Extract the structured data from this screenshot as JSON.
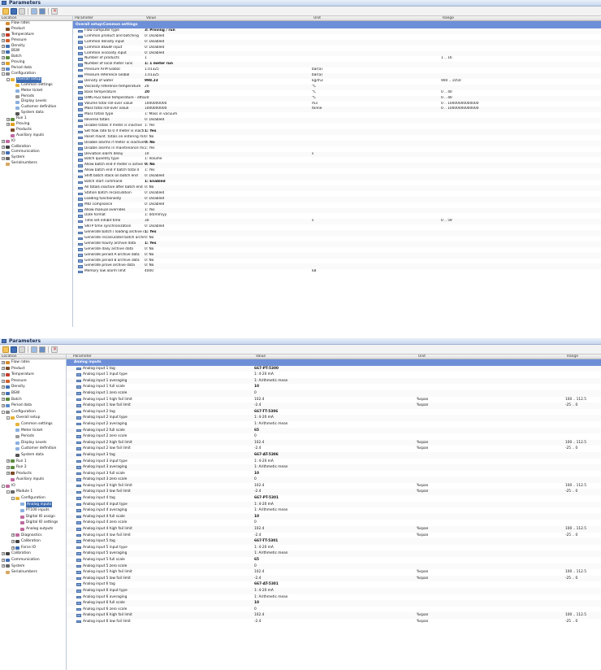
{
  "window1": {
    "title": "Parameters",
    "tree_header": "Location",
    "grid_headers": {
      "parameter": "Parameter",
      "value": "Value",
      "unit": "Unit",
      "range": "Range"
    },
    "section": "Overall setup\\Common settings",
    "tree": [
      {
        "label": "Flow rates",
        "indent": 0,
        "exp": "",
        "icon": "#d48b2e"
      },
      {
        "label": "Product",
        "indent": 0,
        "exp": "",
        "icon": "#7a4b26"
      },
      {
        "label": "Temperature",
        "indent": 0,
        "exp": "+",
        "icon": "#c83c2c"
      },
      {
        "label": "Pressure",
        "indent": 0,
        "exp": "+",
        "icon": "#d0602a"
      },
      {
        "label": "Density",
        "indent": 0,
        "exp": "+",
        "icon": "#3f6fb5"
      },
      {
        "label": "BSW",
        "indent": 0,
        "exp": "+",
        "icon": "#3f6fb5"
      },
      {
        "label": "Batch",
        "indent": 0,
        "exp": "+",
        "icon": "#5c8a3c"
      },
      {
        "label": "Proving",
        "indent": 0,
        "exp": "+",
        "icon": "#e0a020"
      },
      {
        "label": "Period data",
        "indent": 0,
        "exp": "+",
        "icon": "#5a8ad0"
      },
      {
        "label": "Configuration",
        "indent": 0,
        "exp": "-",
        "icon": "#8a8a8a"
      },
      {
        "label": "Overall setup",
        "indent": 1,
        "exp": "-",
        "icon": "#e6b33a",
        "selected": true
      },
      {
        "label": "Common settings",
        "indent": 2,
        "exp": "",
        "icon": "#e6b33a"
      },
      {
        "label": "Meter ticket",
        "indent": 2,
        "exp": "",
        "icon": "#8ab0e0"
      },
      {
        "label": "Periods",
        "indent": 2,
        "exp": "",
        "icon": "#9a9a9a"
      },
      {
        "label": "Display Levels",
        "indent": 2,
        "exp": "",
        "icon": "#8ab0e0"
      },
      {
        "label": "Customer definition",
        "indent": 2,
        "exp": "",
        "icon": "#8ab0e0"
      },
      {
        "label": "System data",
        "indent": 2,
        "exp": "",
        "icon": "#555"
      },
      {
        "label": "Run 1",
        "indent": 1,
        "exp": "+",
        "icon": "#5c8a3c"
      },
      {
        "label": "Proving",
        "indent": 1,
        "exp": "+",
        "icon": "#e0a020"
      },
      {
        "label": "Products",
        "indent": 1,
        "exp": "",
        "icon": "#7a4b26"
      },
      {
        "label": "Auxiliary inputs",
        "indent": 1,
        "exp": "",
        "icon": "#c06aa0"
      },
      {
        "label": "IO",
        "indent": 0,
        "exp": "+",
        "icon": "#c06aa0"
      },
      {
        "label": "Calibration",
        "indent": 0,
        "exp": "+",
        "icon": "#444"
      },
      {
        "label": "Communication",
        "indent": 0,
        "exp": "+",
        "icon": "#3f6fb5"
      },
      {
        "label": "System",
        "indent": 0,
        "exp": "+",
        "icon": "#666"
      },
      {
        "label": "Serialnumbers",
        "indent": 0,
        "exp": "",
        "icon": "#d9a760"
      }
    ],
    "rows": [
      {
        "p": "Flow computer type",
        "v": "3: Proving / run",
        "u": "",
        "r": "",
        "b": true
      },
      {
        "p": "Common product and batching",
        "v": "0: Disabled",
        "u": "",
        "r": ""
      },
      {
        "p": "Common density input",
        "v": "0: Disabled",
        "u": "",
        "r": ""
      },
      {
        "p": "Common BS&W input",
        "v": "0: Disabled",
        "u": "",
        "r": ""
      },
      {
        "p": "Common viscosity input",
        "v": "0: Disabled",
        "u": "",
        "r": ""
      },
      {
        "p": "Number of products",
        "v": "1",
        "u": "",
        "r": "1 .. 16"
      },
      {
        "p": "Number of local meter runs",
        "v": "1: 1 meter run",
        "u": "",
        "r": "",
        "b": true
      },
      {
        "p": "Pressure ATM Global",
        "v": "1.01325",
        "u": "bar(a)",
        "r": ""
      },
      {
        "p": "Pressure reference Global",
        "v": "1.01325",
        "u": "bar(a)",
        "r": ""
      },
      {
        "p": "Density of water",
        "v": "998.23",
        "u": "kg/m3",
        "r": "900 .. 1050",
        "b": true
      },
      {
        "p": "Viscosity reference temperature",
        "v": "20",
        "u": "°C",
        "r": ""
      },
      {
        "p": "Base temperature",
        "v": "20",
        "u": "°C",
        "r": "0 .. 40",
        "b": true
      },
      {
        "p": "OIML-R22 base temperature - ethanol",
        "v": "20",
        "u": "°C",
        "r": "0 .. 40"
      },
      {
        "p": "Volume total roll-over value",
        "v": "1000000000",
        "u": "m3",
        "r": "0 .. 10000000000000"
      },
      {
        "p": "Mass total roll-over value",
        "v": "1000000000",
        "u": "tonne",
        "r": "0 .. 10000000000000"
      },
      {
        "p": "Mass totals type",
        "v": "1: Mass in vacuum",
        "u": "",
        "r": ""
      },
      {
        "p": "Reverse totals",
        "v": "0: Disabled",
        "u": "",
        "r": ""
      },
      {
        "p": "Disable totals if meter is inactive",
        "v": "1: Yes",
        "u": "",
        "r": ""
      },
      {
        "p": "Set flow rate to 0 if meter is inactive",
        "v": "1: Yes",
        "u": "",
        "r": "",
        "b": true
      },
      {
        "p": "Reset maint. totals on entering maint. mode",
        "v": "0: No",
        "u": "",
        "r": ""
      },
      {
        "p": "Disable alarms if meter is inactive",
        "v": "0: No",
        "u": "",
        "r": "",
        "b": true
      },
      {
        "p": "Disable alarms in maintenance mode",
        "v": "1: Yes",
        "u": "",
        "r": ""
      },
      {
        "p": "Deviation alarm delay",
        "v": "10",
        "u": "s",
        "r": ""
      },
      {
        "p": "Batch quantity type",
        "v": "1: Volume",
        "u": "",
        "r": ""
      },
      {
        "p": "Allow batch end if meter is active",
        "v": "0: No",
        "u": "",
        "r": "",
        "b": true
      },
      {
        "p": "Allow batch end if batch total 0",
        "v": "1: Yes",
        "u": "",
        "r": ""
      },
      {
        "p": "Shift batch stack on batch end",
        "v": "0: Disabled",
        "u": "",
        "r": ""
      },
      {
        "p": "Batch start command",
        "v": "1: Enabled",
        "u": "",
        "r": "",
        "b": true
      },
      {
        "p": "All totals inactive after batch end",
        "v": "0: No",
        "u": "",
        "r": ""
      },
      {
        "p": "Station batch recalculation",
        "v": "0: Disabled",
        "u": "",
        "r": ""
      },
      {
        "p": "Loading functionality",
        "v": "0: Disabled",
        "u": "",
        "r": ""
      },
      {
        "p": "MID compliance",
        "v": "0: Disabled",
        "u": "",
        "r": ""
      },
      {
        "p": "Allow manual overrides",
        "v": "1: Yes",
        "u": "",
        "r": ""
      },
      {
        "p": "Date format",
        "v": "1: dd/mm/yy",
        "u": "",
        "r": ""
      },
      {
        "p": "Time set inhibit time",
        "v": "30",
        "u": "s",
        "r": "0 .. 59"
      },
      {
        "p": "SNTP time synchronization",
        "v": "0: Disabled",
        "u": "",
        "r": ""
      },
      {
        "p": "Generate batch / loading archive data",
        "v": "1: Yes",
        "u": "",
        "r": "",
        "b": true
      },
      {
        "p": "Generate recalculated batch archive data",
        "v": "0: No",
        "u": "",
        "r": ""
      },
      {
        "p": "Generate hourly archive data",
        "v": "1: Yes",
        "u": "",
        "r": "",
        "b": true
      },
      {
        "p": "Generate daily archive data",
        "v": "0: No",
        "u": "",
        "r": ""
      },
      {
        "p": "Generate period A archive data",
        "v": "0: No",
        "u": "",
        "r": ""
      },
      {
        "p": "Generate period B archive data",
        "v": "0: No",
        "u": "",
        "r": ""
      },
      {
        "p": "Generate prove archive data",
        "v": "0: No",
        "u": "",
        "r": ""
      },
      {
        "p": "Memory low alarm limit",
        "v": "4000",
        "u": "kB",
        "r": ""
      }
    ]
  },
  "window2": {
    "title": "Parameters",
    "tree_header": "Location",
    "grid_headers": {
      "parameter": "Parameter",
      "value": "Value",
      "unit": "Unit",
      "range": "Range"
    },
    "section": "Analog inputs",
    "tree": [
      {
        "label": "Flow rates",
        "indent": 0,
        "exp": "+",
        "icon": "#d48b2e"
      },
      {
        "label": "Product",
        "indent": 0,
        "exp": "+",
        "icon": "#7a4b26"
      },
      {
        "label": "Temperature",
        "indent": 0,
        "exp": "+",
        "icon": "#c83c2c"
      },
      {
        "label": "Pressure",
        "indent": 0,
        "exp": "+",
        "icon": "#d0602a"
      },
      {
        "label": "Density",
        "indent": 0,
        "exp": "+",
        "icon": "#3f6fb5"
      },
      {
        "label": "BSW",
        "indent": 0,
        "exp": "+",
        "icon": "#3f6fb5"
      },
      {
        "label": "Batch",
        "indent": 0,
        "exp": "+",
        "icon": "#5c8a3c"
      },
      {
        "label": "Period data",
        "indent": 0,
        "exp": "+",
        "icon": "#5a8ad0"
      },
      {
        "label": "Configuration",
        "indent": 0,
        "exp": "-",
        "icon": "#8a8a8a"
      },
      {
        "label": "Overall setup",
        "indent": 1,
        "exp": "-",
        "icon": "#e6b33a"
      },
      {
        "label": "Common settings",
        "indent": 2,
        "exp": "",
        "icon": "#e6b33a"
      },
      {
        "label": "Meter ticket",
        "indent": 2,
        "exp": "",
        "icon": "#8ab0e0"
      },
      {
        "label": "Periods",
        "indent": 2,
        "exp": "",
        "icon": "#9a9a9a"
      },
      {
        "label": "Display Levels",
        "indent": 2,
        "exp": "",
        "icon": "#8ab0e0"
      },
      {
        "label": "Customer definition",
        "indent": 2,
        "exp": "",
        "icon": "#8ab0e0"
      },
      {
        "label": "System data",
        "indent": 2,
        "exp": "",
        "icon": "#555"
      },
      {
        "label": "Run 1",
        "indent": 1,
        "exp": "+",
        "icon": "#5c8a3c"
      },
      {
        "label": "Run 2",
        "indent": 1,
        "exp": "+",
        "icon": "#5c8a3c"
      },
      {
        "label": "Products",
        "indent": 1,
        "exp": "+",
        "icon": "#7a4b26"
      },
      {
        "label": "Auxiliary inputs",
        "indent": 1,
        "exp": "",
        "icon": "#c06aa0"
      },
      {
        "label": "IO",
        "indent": 0,
        "exp": "-",
        "icon": "#c06aa0"
      },
      {
        "label": "Module 1",
        "indent": 1,
        "exp": "-",
        "icon": "#666"
      },
      {
        "label": "Configuration",
        "indent": 2,
        "exp": "-",
        "icon": "#e6b33a"
      },
      {
        "label": "Analog inputs",
        "indent": 3,
        "exp": "",
        "icon": "#8ab0e0",
        "selected": true
      },
      {
        "label": "PT100 inputs",
        "indent": 3,
        "exp": "",
        "icon": "#8ab0e0"
      },
      {
        "label": "Digital IO assign",
        "indent": 3,
        "exp": "",
        "icon": "#c06aa0"
      },
      {
        "label": "Digital IO settings",
        "indent": 3,
        "exp": "",
        "icon": "#c06aa0"
      },
      {
        "label": "Analog outputs",
        "indent": 3,
        "exp": "",
        "icon": "#c06aa0"
      },
      {
        "label": "Diagnostics",
        "indent": 2,
        "exp": "+",
        "icon": "#c06aa0"
      },
      {
        "label": "Calibration",
        "indent": 2,
        "exp": "+",
        "icon": "#444"
      },
      {
        "label": "Force IO",
        "indent": 2,
        "exp": "+",
        "icon": "#3f6fb5"
      },
      {
        "label": "Calibration",
        "indent": 0,
        "exp": "+",
        "icon": "#444"
      },
      {
        "label": "Communication",
        "indent": 0,
        "exp": "+",
        "icon": "#3f6fb5"
      },
      {
        "label": "System",
        "indent": 0,
        "exp": "+",
        "icon": "#666"
      },
      {
        "label": "Serialnumbers",
        "indent": 0,
        "exp": "",
        "icon": "#d9a760"
      }
    ],
    "rows": [
      {
        "p": "Analog input 1 tag",
        "v": "667-PT-5300",
        "u": "",
        "r": "",
        "b": true
      },
      {
        "p": "Analog input 1 input type",
        "v": "1: 4-20 mA",
        "u": "",
        "r": ""
      },
      {
        "p": "Analog input 1 averaging",
        "v": "1: Arithmetic mean",
        "u": "",
        "r": ""
      },
      {
        "p": "Analog input 1 full scale",
        "v": "10",
        "u": "",
        "r": "",
        "b": true
      },
      {
        "p": "Analog input 1 zero scale",
        "v": "0",
        "u": "",
        "r": ""
      },
      {
        "p": "Analog input 1 high fail limit",
        "v": "102.4",
        "u": "%span",
        "r": "100 .. 112.5"
      },
      {
        "p": "Analog input 1 low fail limit",
        "v": "-2.4",
        "u": "%span",
        "r": "-25 .. 0"
      },
      {
        "p": "Analog input 2 tag",
        "v": "667-TT-5306",
        "u": "",
        "r": "",
        "b": true
      },
      {
        "p": "Analog input 2 input type",
        "v": "1: 4-20 mA",
        "u": "",
        "r": ""
      },
      {
        "p": "Analog input 2 averaging",
        "v": "1: Arithmetic mean",
        "u": "",
        "r": ""
      },
      {
        "p": "Analog input 2 full scale",
        "v": "65",
        "u": "",
        "r": "",
        "b": true
      },
      {
        "p": "Analog input 2 zero scale",
        "v": "0",
        "u": "",
        "r": ""
      },
      {
        "p": "Analog input 2 high fail limit",
        "v": "102.4",
        "u": "%span",
        "r": "100 .. 112.5"
      },
      {
        "p": "Analog input 2 low fail limit",
        "v": "-2.4",
        "u": "%span",
        "r": "-25 .. 0"
      },
      {
        "p": "Analog input 3 tag",
        "v": "667-AT-5306",
        "u": "",
        "r": "",
        "b": true
      },
      {
        "p": "Analog input 3 input type",
        "v": "1: 4-20 mA",
        "u": "",
        "r": ""
      },
      {
        "p": "Analog input 3 averaging",
        "v": "1: Arithmetic mean",
        "u": "",
        "r": ""
      },
      {
        "p": "Analog input 3 full scale",
        "v": "10",
        "u": "",
        "r": "",
        "b": true
      },
      {
        "p": "Analog input 3 zero scale",
        "v": "0",
        "u": "",
        "r": ""
      },
      {
        "p": "Analog input 3 high fail limit",
        "v": "102.4",
        "u": "%span",
        "r": "100 .. 112.5"
      },
      {
        "p": "Analog input 3 low fail limit",
        "v": "-2.4",
        "u": "%span",
        "r": "-25 .. 0"
      },
      {
        "p": "Analog input 4 tag",
        "v": "667-PT-5301",
        "u": "",
        "r": "",
        "b": true
      },
      {
        "p": "Analog input 4 input type",
        "v": "1: 4-20 mA",
        "u": "",
        "r": ""
      },
      {
        "p": "Analog input 4 averaging",
        "v": "1: Arithmetic mean",
        "u": "",
        "r": ""
      },
      {
        "p": "Analog input 4 full scale",
        "v": "10",
        "u": "",
        "r": "",
        "b": true
      },
      {
        "p": "Analog input 4 zero scale",
        "v": "0",
        "u": "",
        "r": ""
      },
      {
        "p": "Analog input 4 high fail limit",
        "v": "102.4",
        "u": "%span",
        "r": "100 .. 112.5"
      },
      {
        "p": "Analog input 4 low fail limit",
        "v": "-2.4",
        "u": "%span",
        "r": "-25 .. 0"
      },
      {
        "p": "Analog input 5 tag",
        "v": "667-TT-5301",
        "u": "",
        "r": "",
        "b": true
      },
      {
        "p": "Analog input 5 input type",
        "v": "1: 4-20 mA",
        "u": "",
        "r": ""
      },
      {
        "p": "Analog input 5 averaging",
        "v": "1: Arithmetic mean",
        "u": "",
        "r": ""
      },
      {
        "p": "Analog input 5 full scale",
        "v": "65",
        "u": "",
        "r": "",
        "b": true
      },
      {
        "p": "Analog input 5 zero scale",
        "v": "0",
        "u": "",
        "r": ""
      },
      {
        "p": "Analog input 5 high fail limit",
        "v": "102.4",
        "u": "%span",
        "r": "100 .. 112.5"
      },
      {
        "p": "Analog input 5 low fail limit",
        "v": "-2.4",
        "u": "%span",
        "r": "-25 .. 0"
      },
      {
        "p": "Analog input 6 tag",
        "v": "667-AT-5301",
        "u": "",
        "r": "",
        "b": true
      },
      {
        "p": "Analog input 6 input type",
        "v": "1: 4-20 mA",
        "u": "",
        "r": ""
      },
      {
        "p": "Analog input 6 averaging",
        "v": "1: Arithmetic mean",
        "u": "",
        "r": ""
      },
      {
        "p": "Analog input 6 full scale",
        "v": "10",
        "u": "",
        "r": "",
        "b": true
      },
      {
        "p": "Analog input 6 zero scale",
        "v": "0",
        "u": "",
        "r": ""
      },
      {
        "p": "Analog input 6 high fail limit",
        "v": "102.4",
        "u": "%span",
        "r": "100 .. 112.5"
      },
      {
        "p": "Analog input 6 low fail limit",
        "v": "-2.4",
        "u": "%span",
        "r": "-25 .. 0"
      }
    ]
  }
}
